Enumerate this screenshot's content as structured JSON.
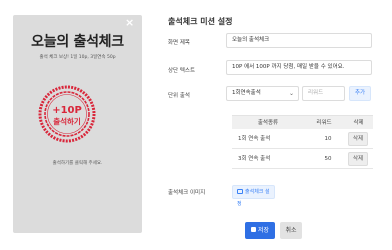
{
  "preview": {
    "close_glyph": "×",
    "title": "오늘의 출석체크",
    "subtitle": "출석 체크 보상! 1일 10p, 3일연속 50p",
    "stamp_line1": "+10P",
    "stamp_line2": "출석하기",
    "hint": "출석하기를 클릭해 주세요."
  },
  "settings": {
    "heading": "출석체크 미션 설정",
    "screen_title_label": "화면 제목",
    "screen_title_value": "오늘의 출석체크",
    "top_text_label": "상단 텍스트",
    "top_text_value": "10P 에서 100P 까지 당첨, 매일 받을 수 있어요.",
    "unit_label": "단위 출석",
    "unit_select_value": "1회연속출석",
    "reward_placeholder": "리워드",
    "add_button": "추가",
    "table": {
      "headers": [
        "출석종류",
        "리워드",
        "삭제"
      ],
      "rows": [
        {
          "type": "1회 연속 출석",
          "reward": "10",
          "action": "삭제"
        },
        {
          "type": "3회 연속 출석",
          "reward": "50",
          "action": "삭제"
        }
      ]
    },
    "image_label": "출석체크 이미지",
    "image_button": "출석체크 설정",
    "save_button": "저장",
    "cancel_button": "취소"
  },
  "colors": {
    "accent": "#2f6fe4",
    "stamp_red": "#d9263a",
    "preview_bg": "#dcdcdc"
  }
}
